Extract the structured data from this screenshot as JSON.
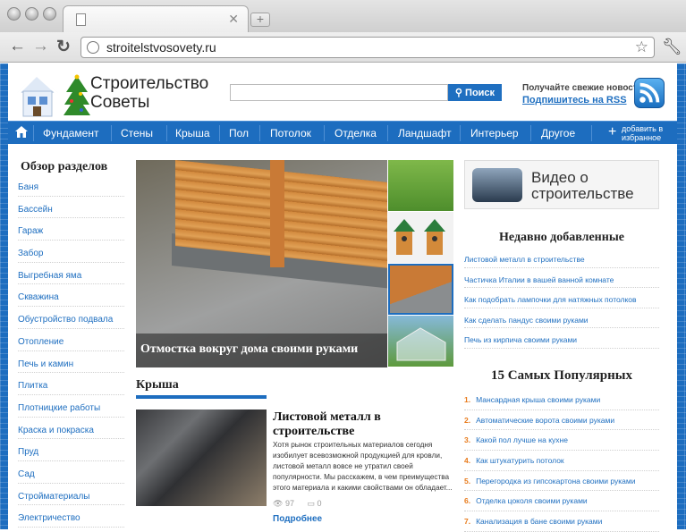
{
  "browser": {
    "url": "stroitelstvosovety.ru"
  },
  "site": {
    "logo_line1": "Строительство",
    "logo_line2": "Советы",
    "search_placeholder": "",
    "search_button": "Поиск",
    "rss_text": "Получайте свежие новости",
    "rss_link": "Подпишитесь на RSS"
  },
  "nav": {
    "items": [
      "Фундамент",
      "Стены",
      "Крыша",
      "Пол",
      "Потолок",
      "Отделка",
      "Ландшафт",
      "Интерьер",
      "Другое"
    ],
    "fav_line1": "добавить в",
    "fav_line2": "избранное"
  },
  "sidebar": {
    "title": "Обзор разделов",
    "items": [
      "Баня",
      "Бассейн",
      "Гараж",
      "Забор",
      "Выгребная яма",
      "Скважина",
      "Обустройство подвала",
      "Отопление",
      "Печь и камин",
      "Плитка",
      "Плотницкие работы",
      "Краска и покраска",
      "Пруд",
      "Сад",
      "Стройматериалы",
      "Электричество"
    ]
  },
  "hero": {
    "caption": "Отмостка вокруг дома своими руками"
  },
  "section": {
    "label": "Крыша"
  },
  "article": {
    "title": "Листовой металл в строительстве",
    "text": "Хотя рынок строительных материалов сегодня изобилует всевозможной продукцией для кровли, листовой металл вовсе не утратил своей популярности. Мы расскажем, в чем преимущества этого материала и какими свойствами он обладает...",
    "views": "97",
    "comments": "0",
    "more": "Подробнее"
  },
  "right": {
    "video_line1": "Видео о",
    "video_line2": "строительстве",
    "recent_title": "Недавно добавленные",
    "recent": [
      "Листовой металл в строительстве",
      "Частичка Италии в вашей ванной комнате",
      "Как подобрать лампочки для натяжных потолков",
      "Как сделать пандус своими руками",
      "Печь из кирпича своими руками"
    ],
    "popular_title": "15 Самых Популярных",
    "popular": [
      {
        "n": "1.",
        "t": "Мансардная крыша своими руками"
      },
      {
        "n": "2.",
        "t": "Автоматические ворота своими руками"
      },
      {
        "n": "3.",
        "t": "Какой пол лучше на кухне"
      },
      {
        "n": "4.",
        "t": "Как штукатурить потолок"
      },
      {
        "n": "5.",
        "t": "Перегородка из гипсокартона своими руками"
      },
      {
        "n": "6.",
        "t": "Отделка цоколя своими руками"
      },
      {
        "n": "7.",
        "t": "Канализация в бане своими руками"
      }
    ]
  }
}
